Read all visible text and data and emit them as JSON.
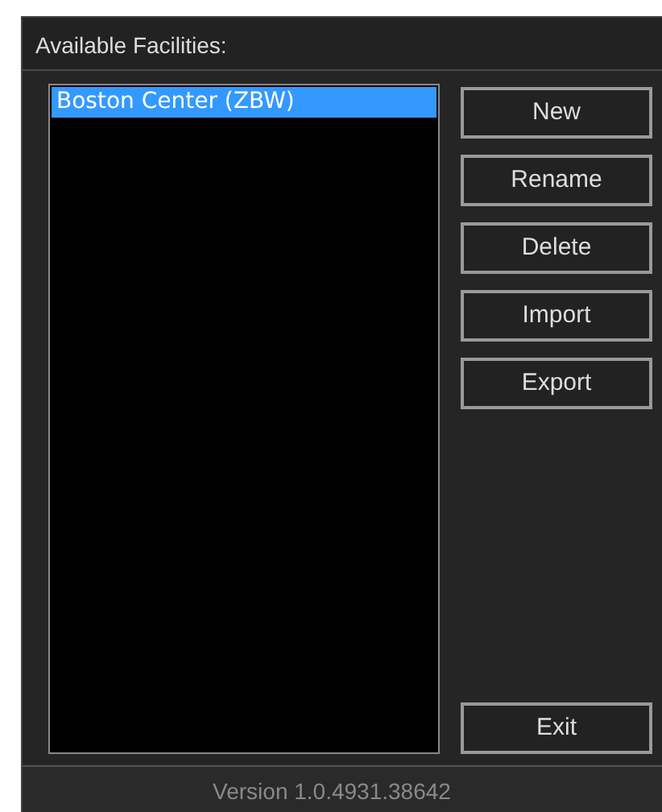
{
  "header": {
    "title": "Available Facilities:"
  },
  "facilities": [
    {
      "label": "Boston Center (ZBW)",
      "selected": true
    }
  ],
  "buttons": [
    {
      "label": "New"
    },
    {
      "label": "Rename"
    },
    {
      "label": "Delete"
    },
    {
      "label": "Import"
    },
    {
      "label": "Export"
    }
  ],
  "exit_button": {
    "label": "Exit"
  },
  "status_bar": {
    "version": "Version 1.0.4931.38642"
  }
}
